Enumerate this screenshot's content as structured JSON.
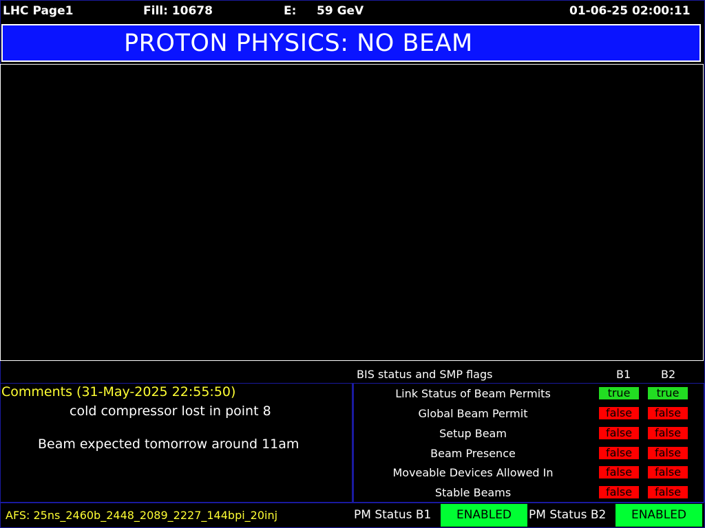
{
  "header": {
    "page": "LHC Page1",
    "fill": "Fill: 10678",
    "energy_label": "E:",
    "energy_value": "59 GeV",
    "datetime": "01-06-25 02:00:11"
  },
  "banner": {
    "text": "PROTON PHYSICS: NO BEAM"
  },
  "bis": {
    "title": "BIS status and SMP flags",
    "col_b1": "B1",
    "col_b2": "B2",
    "rows": [
      {
        "label": "Link Status of Beam Permits",
        "b1": "true",
        "b2": "true"
      },
      {
        "label": "Global Beam Permit",
        "b1": "false",
        "b2": "false"
      },
      {
        "label": "Setup Beam",
        "b1": "false",
        "b2": "false"
      },
      {
        "label": "Beam Presence",
        "b1": "false",
        "b2": "false"
      },
      {
        "label": "Moveable Devices Allowed In",
        "b1": "false",
        "b2": "false"
      },
      {
        "label": "Stable Beams",
        "b1": "false",
        "b2": "false"
      }
    ],
    "colors": {
      "true": "#22dd22",
      "false": "#ff0000"
    }
  },
  "comments": {
    "title": "Comments (31-May-2025 22:55:50)",
    "lines": [
      "cold compressor lost in point 8",
      "Beam expected tomorrow around 11am"
    ]
  },
  "footer": {
    "afs": "AFS: 25ns_2460b_2448_2089_2227_144bpi_20inj",
    "pm_b1_label": "PM Status B1",
    "pm_b1_value": "ENABLED",
    "pm_b2_label": "PM Status B2",
    "pm_b2_value": "ENABLED"
  },
  "colors": {
    "banner": "#0a14ff",
    "accent_text": "#ffff33",
    "enabled": "#00ff33"
  }
}
